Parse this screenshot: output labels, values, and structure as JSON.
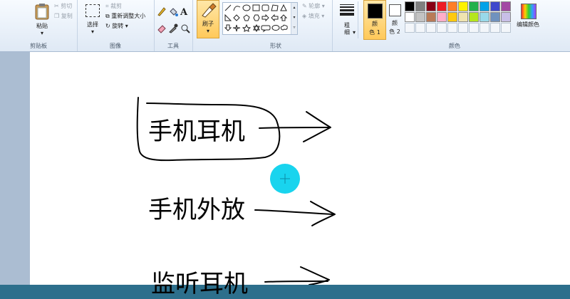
{
  "ribbon": {
    "clipboard": {
      "paste_label": "粘贴",
      "cut_label": "剪切",
      "copy_label": "复制",
      "group_label": "剪贴板"
    },
    "image": {
      "select_label": "选择",
      "crop_label": "裁剪",
      "resize_label": "重新调整大小",
      "rotate_label": "旋转",
      "group_label": "图像"
    },
    "tools": {
      "group_label": "工具",
      "text_tool_glyph": "A"
    },
    "brushes": {
      "brush_label": "刷子"
    },
    "shapes": {
      "outline_label": "轮廓",
      "fill_label": "填充",
      "group_label": "形状"
    },
    "size": {
      "label_line1": "粗",
      "label_line2": "细"
    },
    "colors": {
      "color1_line1": "颜",
      "color1_line2": "色 1",
      "color2_line1": "颜",
      "color2_line2": "色 2",
      "edit_label": "编辑颜色",
      "group_label": "颜色",
      "color1_value": "#000000",
      "color2_value": "#ffffff",
      "palette_row1": [
        "#000000",
        "#7f7f7f",
        "#880015",
        "#ed1c24",
        "#ff7f27",
        "#fff200",
        "#22b14c",
        "#00a2e8",
        "#3f48cc",
        "#a349a4"
      ],
      "palette_row2": [
        "#ffffff",
        "#c3c3c3",
        "#b97a57",
        "#ffaec9",
        "#ffc90e",
        "#efe4b0",
        "#b5e61d",
        "#99d9ea",
        "#7092be",
        "#c8bfe7"
      ]
    }
  },
  "canvas": {
    "line1": "手机耳机",
    "line2": "手机外放",
    "line3": "监听耳机",
    "cursor_color": "#19d4ee"
  }
}
